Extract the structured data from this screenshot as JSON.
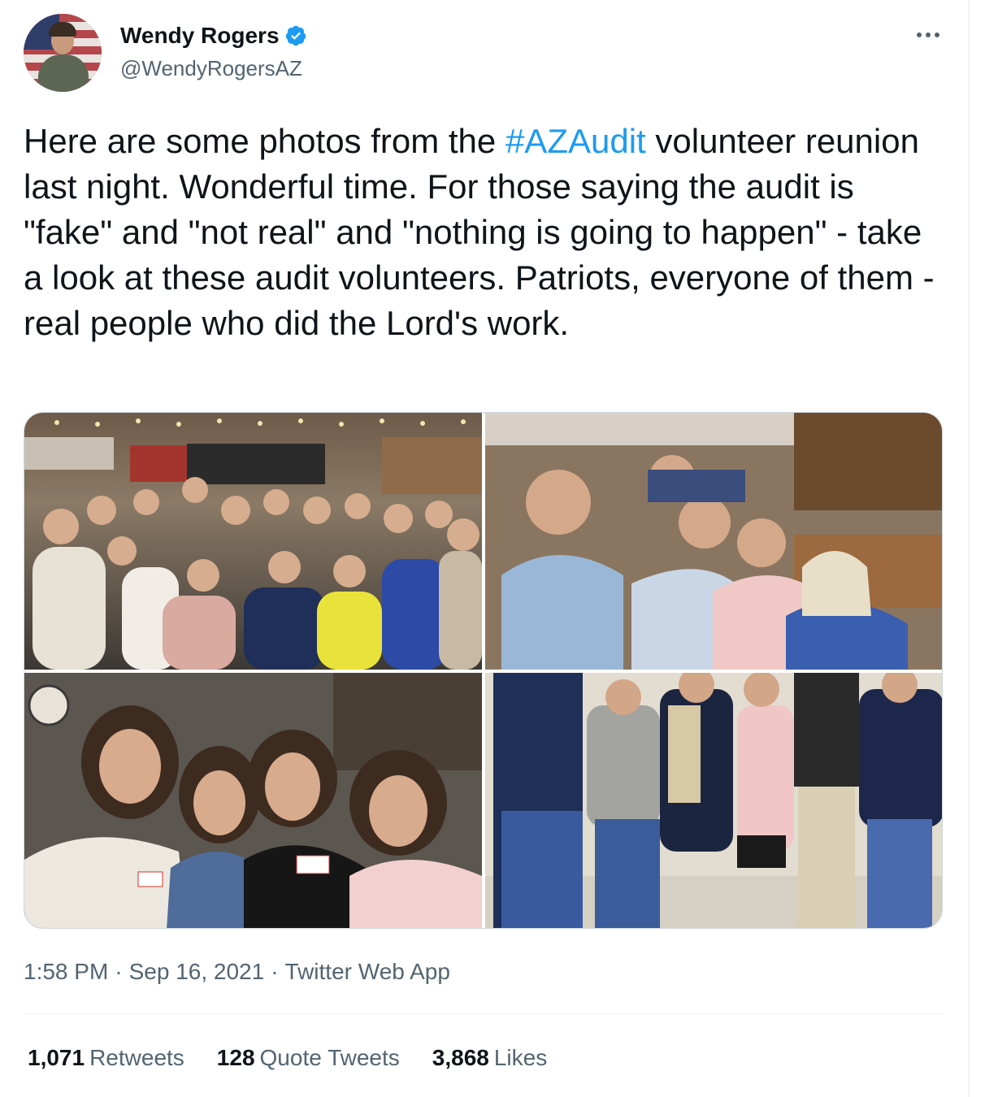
{
  "author": {
    "display_name": "Wendy Rogers",
    "handle": "@WendyRogersAZ",
    "verified": true,
    "avatar_icon": "profile-photo"
  },
  "tweet": {
    "text_before": "Here are some photos from the ",
    "hashtag": "#AZAudit",
    "text_after": " volunteer reunion last night. Wonderful time. For those saying the audit is \"fake\" and \"not real\" and \"nothing is going to happen\" - take a look at these audit volunteers. Patriots, everyone of them - real people who did the Lord's work.",
    "photo_count": 4
  },
  "meta": {
    "time": "1:58 PM",
    "separator": "·",
    "date": "Sep 16, 2021",
    "source": "Twitter Web App"
  },
  "stats": {
    "retweets_count": "1,071",
    "retweets_label": "Retweets",
    "quotes_count": "128",
    "quotes_label": "Quote Tweets",
    "likes_count": "3,868",
    "likes_label": "Likes"
  },
  "colors": {
    "link": "#1d9bf0",
    "text": "#0f1419",
    "secondary": "#536471",
    "border": "#cfd9de"
  },
  "icons": {
    "verified": "verified-badge-icon",
    "more": "more-options-icon"
  }
}
